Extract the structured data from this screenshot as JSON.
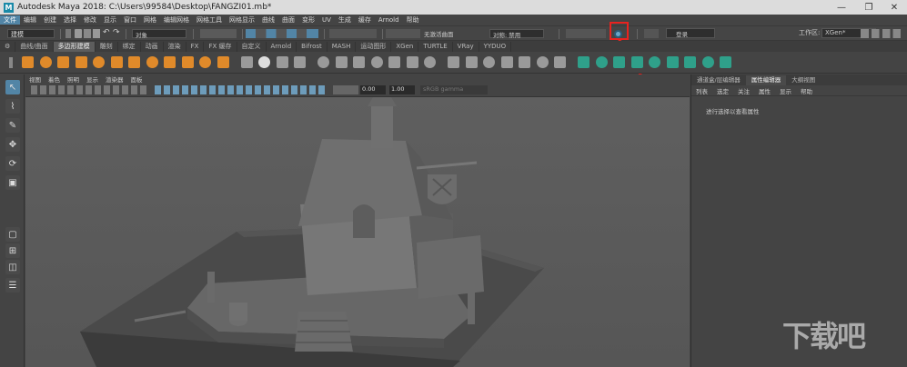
{
  "app": {
    "title": "Autodesk Maya 2018: C:\\Users\\99584\\Desktop\\FANGZI01.mb*",
    "logo_letter": "M",
    "workspace_label": "工作区:",
    "workspace_value": "XGen*"
  },
  "window_controls": {
    "minimize": "—",
    "maximize": "❐",
    "close": "✕"
  },
  "menubar": [
    "文件",
    "编辑",
    "创建",
    "选择",
    "修改",
    "显示",
    "窗口",
    "网格",
    "编辑网格",
    "网格工具",
    "网格显示",
    "曲线",
    "曲面",
    "变形",
    "UV",
    "生成",
    "缓存",
    "Arnold",
    "帮助"
  ],
  "statusline": {
    "mode": "建模",
    "object_label": "对象",
    "live_surface": "无激活曲面",
    "symmetry": "对称: 禁用",
    "login": "登录"
  },
  "shelf_tabs": [
    "曲线/曲面",
    "多边形建模",
    "雕刻",
    "绑定",
    "动画",
    "渲染",
    "FX",
    "FX 缓存",
    "自定义",
    "Arnold",
    "Bifrost",
    "MASH",
    "运动图形",
    "XGen",
    "TURTLE",
    "VRay",
    "YYDUO"
  ],
  "shelf_active": 1,
  "viewport": {
    "menu": [
      "视图",
      "着色",
      "照明",
      "显示",
      "渲染器",
      "面板"
    ],
    "near_value": "0.00",
    "far_value": "1.00",
    "colorspace": "sRGB gamma"
  },
  "panel": {
    "tabs": [
      "通道盒/层编辑器",
      "属性编辑器",
      "大纲视图"
    ],
    "active_tab": 1,
    "menu": [
      "列表",
      "选定",
      "关注",
      "属性",
      "显示",
      "帮助"
    ],
    "message": "进行选择以查看属性"
  },
  "watermark": "下载吧",
  "colors": {
    "accent": "#5285a6",
    "callout": "#e8231f",
    "shelf_green": "#2fa08a",
    "shelf_orange": "#e08a2a"
  }
}
